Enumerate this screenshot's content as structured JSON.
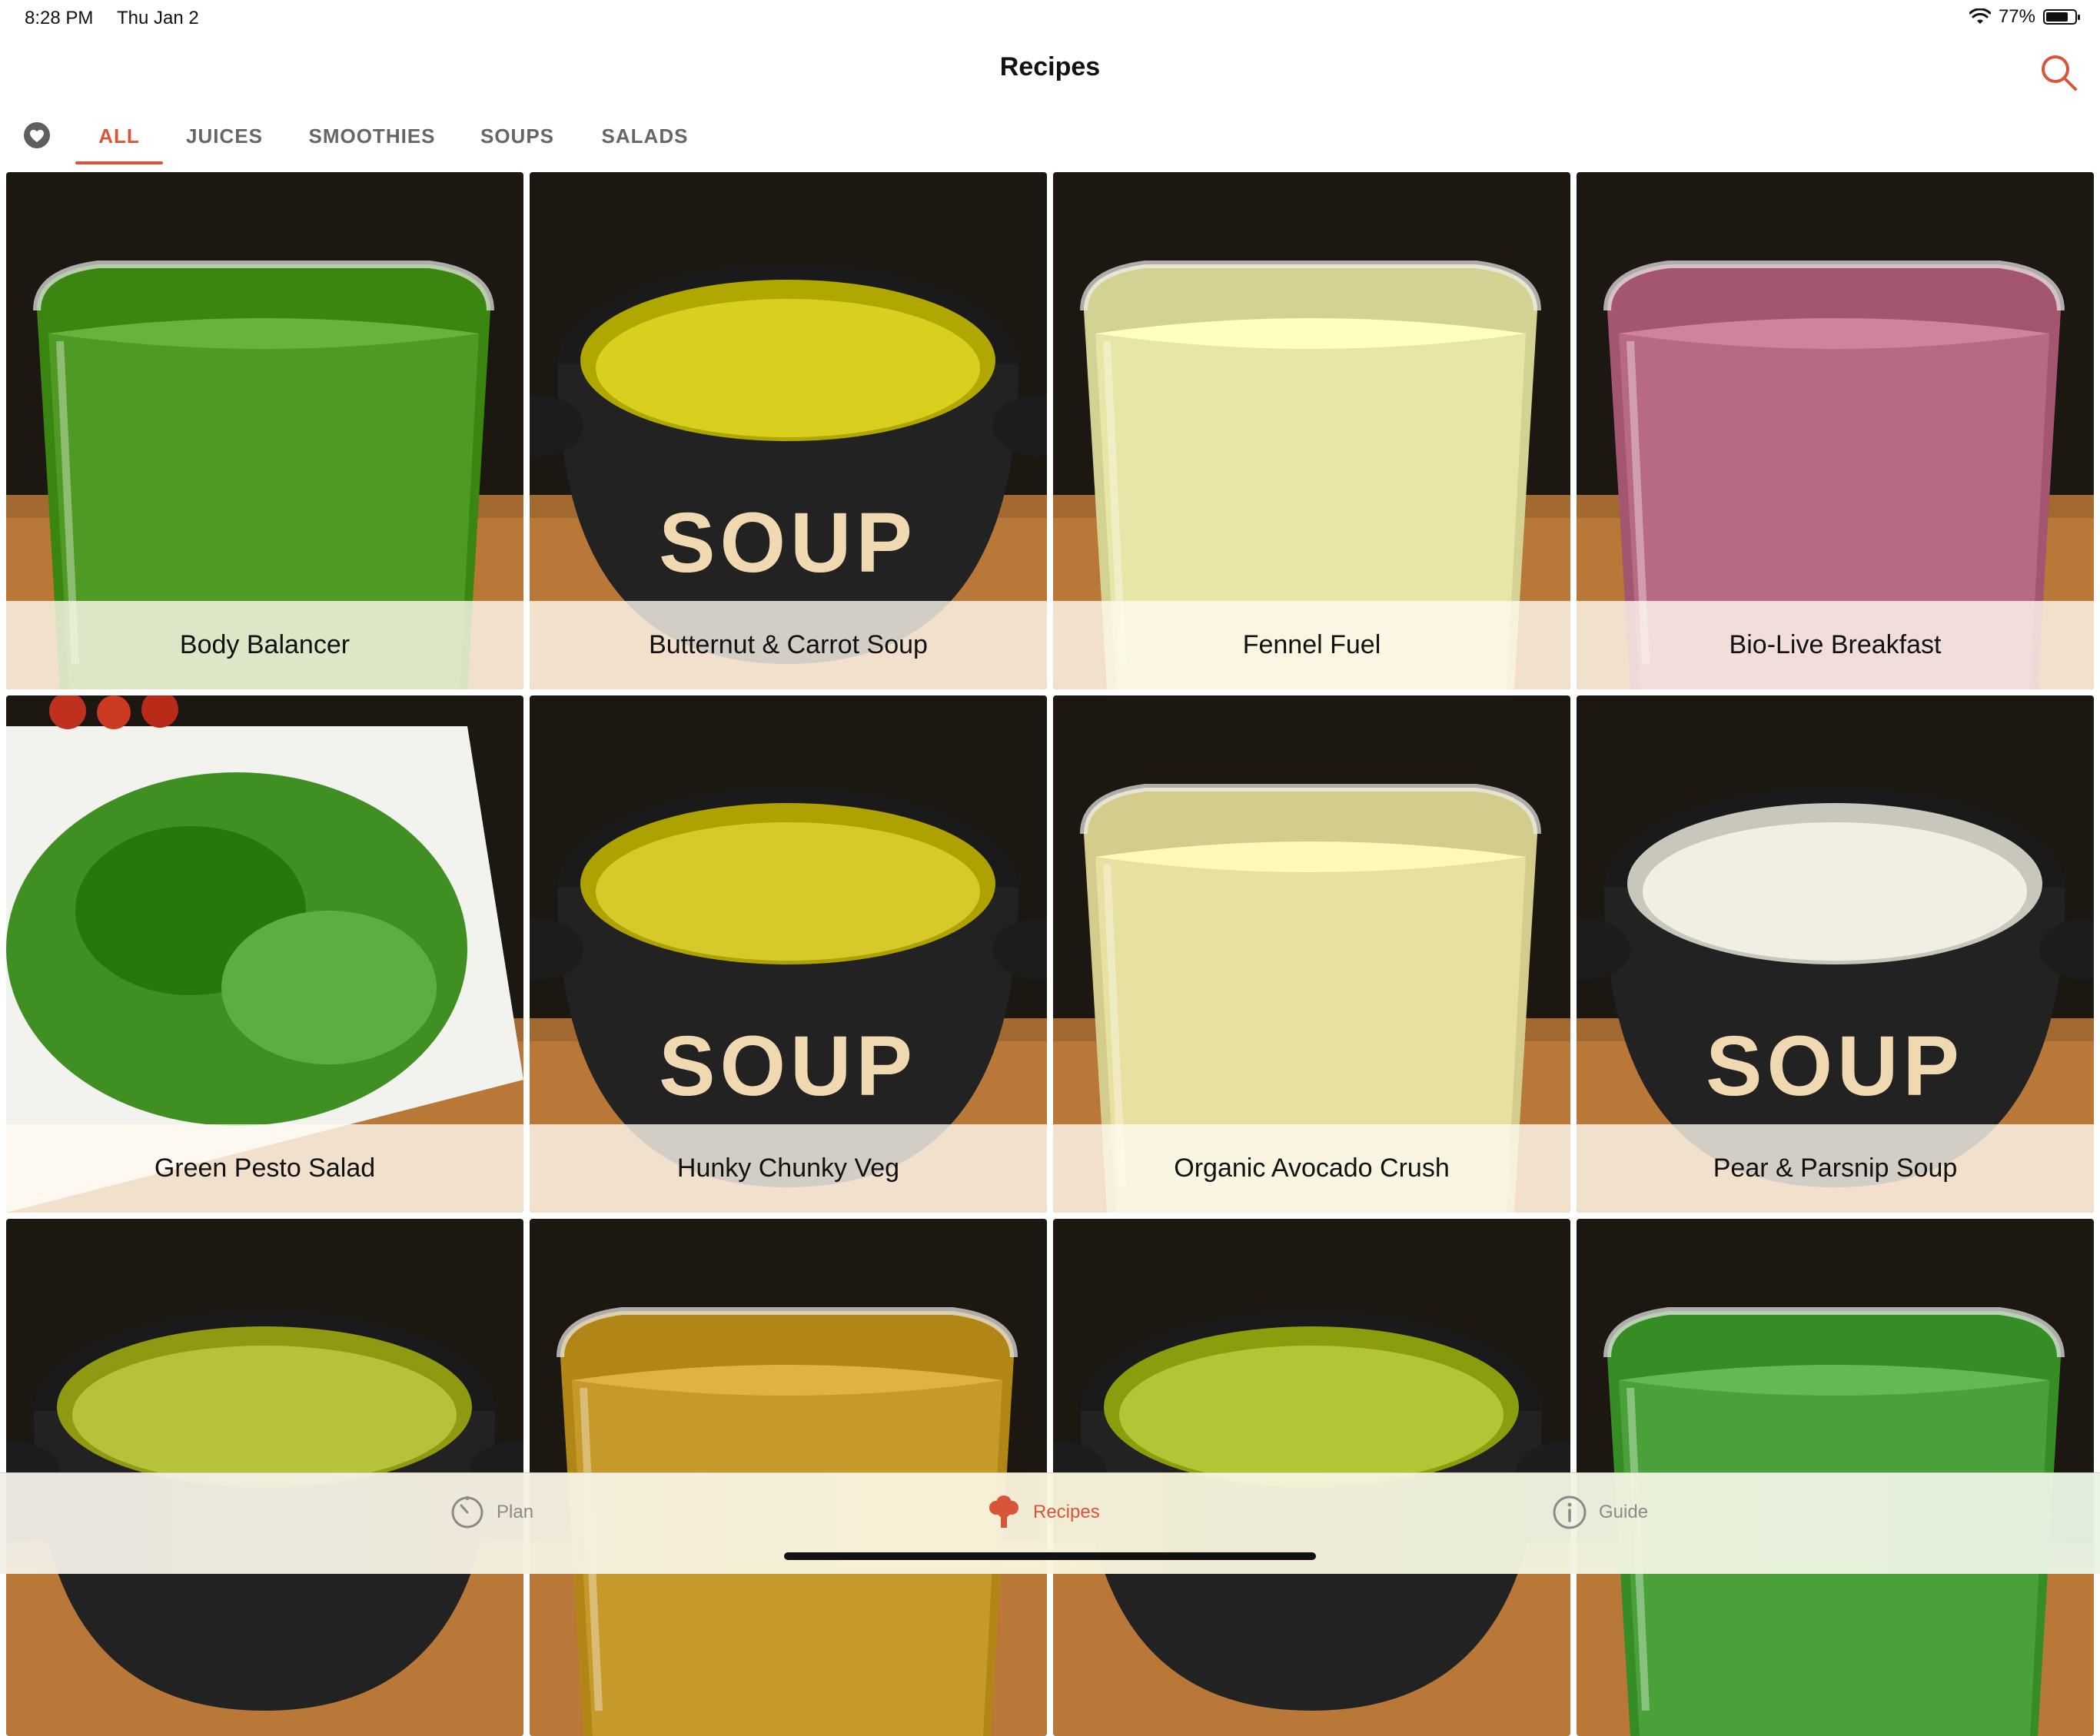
{
  "status": {
    "time": "8:28 PM",
    "date": "Thu Jan 2",
    "battery_text": "77%",
    "battery_level": 0.77
  },
  "nav": {
    "title": "Recipes",
    "search_icon": "search-icon"
  },
  "tabs": [
    {
      "label": "ALL",
      "active": true
    },
    {
      "label": "JUICES",
      "active": false
    },
    {
      "label": "SMOOTHIES",
      "active": false
    },
    {
      "label": "SOUPS",
      "active": false
    },
    {
      "label": "SALADS",
      "active": false
    }
  ],
  "recipes": [
    {
      "name": "Body Balancer",
      "kind": "glass",
      "color": "#4f9a24"
    },
    {
      "name": "Butternut & Carrot Soup",
      "kind": "soup",
      "color": "#d8cf1e",
      "bowl_text": "SOUP"
    },
    {
      "name": "Fennel Fuel",
      "kind": "glass",
      "color": "#e8e6a6"
    },
    {
      "name": "Bio-Live Breakfast",
      "kind": "glass",
      "color": "#b86a84"
    },
    {
      "name": "Green Pesto Salad",
      "kind": "salad",
      "color": "#3f8f22"
    },
    {
      "name": "Hunky Chunky Veg",
      "kind": "soup",
      "color": "#d6c92a",
      "bowl_text": "SOUP"
    },
    {
      "name": "Organic Avocado Crush",
      "kind": "glass",
      "color": "#e7e0a0"
    },
    {
      "name": "Pear & Parsnip Soup",
      "kind": "soup",
      "color": "#f1eee3",
      "bowl_text": "SOUP"
    },
    {
      "name": "",
      "kind": "soup",
      "color": "#b7c23a"
    },
    {
      "name": "",
      "kind": "glass",
      "color": "#c69a2a"
    },
    {
      "name": "",
      "kind": "soup",
      "color": "#b3c434"
    },
    {
      "name": "",
      "kind": "glass",
      "color": "#4aa13a"
    }
  ],
  "bottom_tabs": [
    {
      "label": "Plan",
      "icon": "timer-icon",
      "active": false
    },
    {
      "label": "Recipes",
      "icon": "broccoli-icon",
      "active": true
    },
    {
      "label": "Guide",
      "icon": "info-icon",
      "active": false
    }
  ],
  "colors": {
    "accent": "#d9553a",
    "inactive": "#8a8a8a"
  }
}
